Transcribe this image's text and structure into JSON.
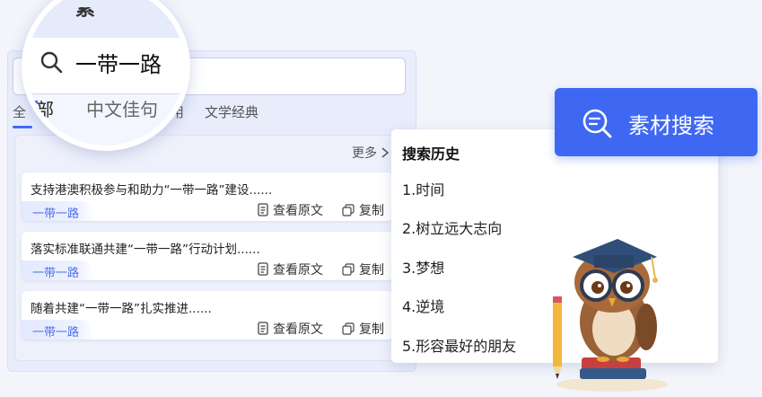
{
  "search": {
    "query": "一带一路"
  },
  "tabs": [
    {
      "label": "全部"
    },
    {
      "label": "中文佳句"
    },
    {
      "label": "名言引用"
    },
    {
      "label": "文学经典"
    }
  ],
  "tabs_visible": {
    "all_partial": "全",
    "usage_partial": "用",
    "classics": "文学经典"
  },
  "lens": {
    "partial_heading": "素",
    "query": "一带一路",
    "tab_all": "部",
    "tab_chinese": "中文佳句"
  },
  "results": {
    "more_label": "更多",
    "items": [
      {
        "text": "支持港澳积极参与和助力“一带一路”建设......",
        "tag": "一带一路"
      },
      {
        "text": "落实标准联通共建“一带一路”行动计划......",
        "tag": "一带一路"
      },
      {
        "text": "随着共建“一带一路”扎实推进......",
        "tag": "一带一路"
      }
    ],
    "view_original_label": "查看原文",
    "copy_label": "复制"
  },
  "history": {
    "title": "搜索历史",
    "items": [
      "1.时间",
      "2.树立远大志向",
      "3.梦想",
      "4.逆境",
      "5.形容最好的朋友"
    ]
  },
  "material_button": {
    "label": "素材搜索"
  },
  "colors": {
    "accent": "#3f68f2",
    "tag_text": "#4e6fe8",
    "panel_bg": "#e8ecfb"
  },
  "icons": [
    "search-icon",
    "chevron-right-icon",
    "document-icon",
    "copy-icon",
    "material-search-icon",
    "owl-mascot-icon"
  ]
}
